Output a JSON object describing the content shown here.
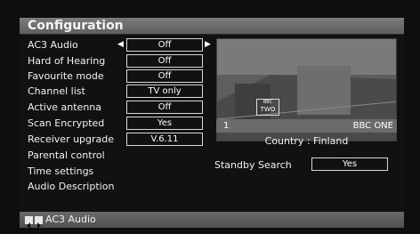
{
  "menu": {
    "title": "Configuration",
    "items": [
      {
        "label": "AC3 Audio",
        "value": "Off"
      },
      {
        "label": "Hard of Hearing",
        "value": "Off"
      },
      {
        "label": "Favourite mode",
        "value": "Off"
      },
      {
        "label": "Channel list",
        "value": "TV only"
      },
      {
        "label": "Active antenna",
        "value": "Off"
      },
      {
        "label": "Scan Encrypted",
        "value": "Yes"
      },
      {
        "label": "Receiver upgrade",
        "value": "V.6.11"
      },
      {
        "label": "Parental control"
      },
      {
        "label": "Time settings"
      },
      {
        "label": "Audio Description"
      }
    ]
  },
  "preview": {
    "logo_line1": "BBC",
    "logo_line2": "TWO",
    "channel_number": "1",
    "channel_name": "BBC ONE"
  },
  "country": "Country : Finland",
  "standby": {
    "label": "Standby Search",
    "value": "Yes"
  },
  "footer": {
    "hint": "AC3 Audio",
    "icons": [
      "left-arrow-key-icon",
      "right-arrow-key-icon"
    ]
  }
}
